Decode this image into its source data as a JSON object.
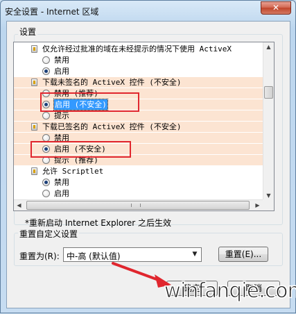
{
  "window": {
    "title": "安全设置 - Internet 区域",
    "close_label": "✕"
  },
  "settings_group": {
    "label": "设置"
  },
  "rows": [
    {
      "kind": "item",
      "text": "仅允许经过批准的域在未经提示的情况下使用 ActiveX",
      "icon": "setting-icon"
    },
    {
      "kind": "option",
      "text": "禁用",
      "checked": false
    },
    {
      "kind": "option",
      "text": "启用",
      "checked": true
    },
    {
      "kind": "item",
      "text": "下载未签名的 ActiveX 控件 (不安全)",
      "icon": "setting-icon"
    },
    {
      "kind": "option",
      "text": "禁用 (推荐)",
      "checked": false
    },
    {
      "kind": "option",
      "text": "启用 (不安全)",
      "checked": true
    },
    {
      "kind": "option",
      "text": "提示",
      "checked": false
    },
    {
      "kind": "item",
      "text": "下载已签名的 ActiveX 控件 (不安全)",
      "icon": "setting-icon"
    },
    {
      "kind": "option",
      "text": "禁用",
      "checked": false
    },
    {
      "kind": "option",
      "text": "启用 (不安全)",
      "checked": true
    },
    {
      "kind": "option",
      "text": "提示 (推荐)",
      "checked": false
    },
    {
      "kind": "item",
      "text": "允许 Scriptlet",
      "icon": "setting-icon"
    },
    {
      "kind": "option",
      "text": "禁用",
      "checked": true
    },
    {
      "kind": "option",
      "text": "启用",
      "checked": false
    }
  ],
  "restart_note": "*重新启动 Internet Explorer 之后生效",
  "reset_group": {
    "label": "重置自定义设置",
    "reset_to_label": "重置为(R):",
    "selected_level": "中-高 (默认值)",
    "reset_button": "重置(E)..."
  },
  "footer": {
    "ok_label": "确定",
    "cancel_label": "取消"
  },
  "watermark": "winfanqie.com",
  "colors": {
    "highlight_row": "#fce4d2",
    "annotation_red": "#e0262e",
    "selection_blue": "#3399ff"
  }
}
